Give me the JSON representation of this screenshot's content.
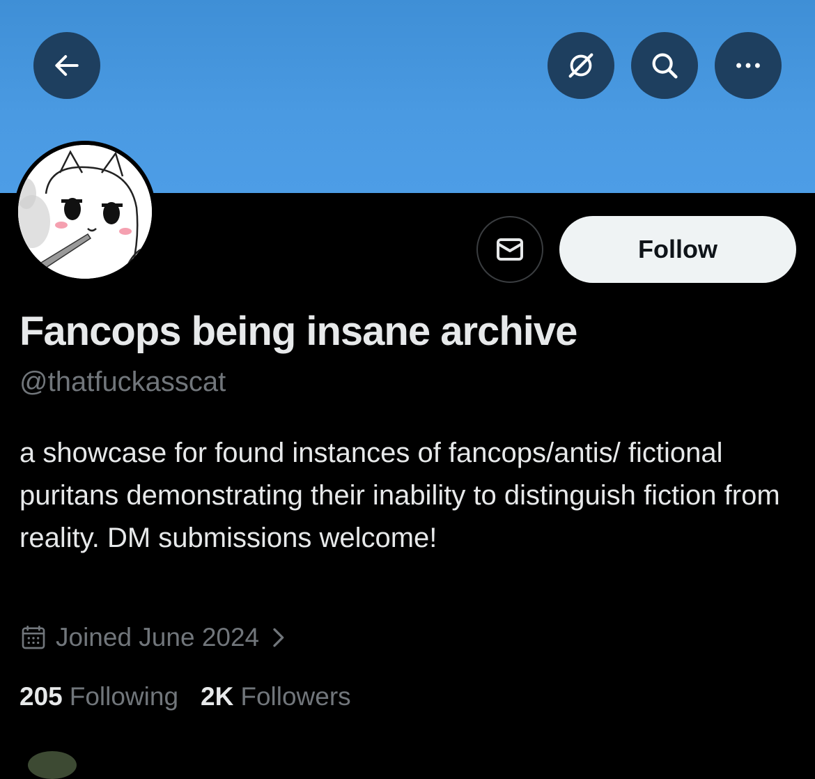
{
  "header": {
    "back_icon": "arrow-left-icon",
    "grok_icon": "grok-icon",
    "search_icon": "search-icon",
    "more_icon": "more-horizontal-icon",
    "banner_color": "#4a9ae2"
  },
  "profile": {
    "display_name": "Fancops being insane archive",
    "handle": "@thatfuckasscat",
    "bio": "a showcase for found instances of fancops/antis/ fictional puritans demonstrating their inability to distinguish fiction from reality. DM submissions welcome!",
    "joined": "Joined June 2024",
    "following_count": "205",
    "following_label": "Following",
    "followers_count": "2K",
    "followers_label": "Followers"
  },
  "actions": {
    "message_icon": "envelope-icon",
    "follow_label": "Follow"
  }
}
